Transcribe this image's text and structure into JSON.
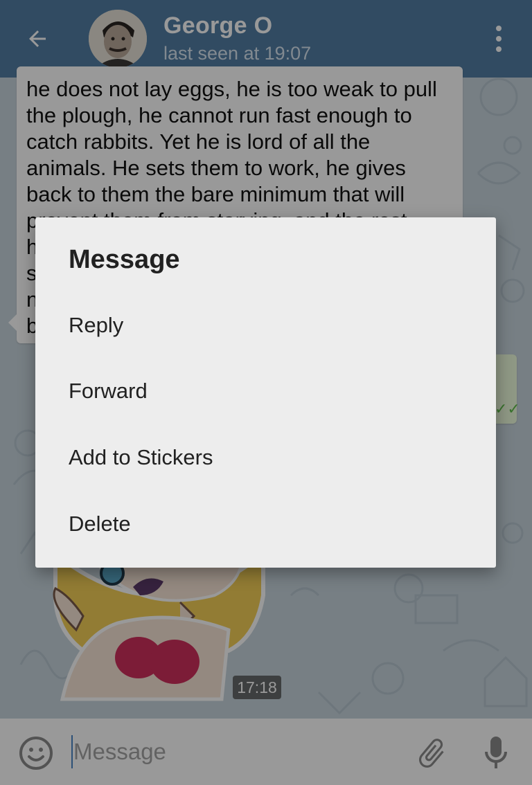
{
  "header": {
    "title": "George O",
    "subtitle": "last seen at 19:07"
  },
  "message": {
    "text": "he does not lay eggs, he is too weak to pull\nthe plough, he cannot run fast enough to\ncatch rabbits. Yet he is lord of all the\nanimals. He sets them to work, he gives\nback to them the bare minimum that will\nprevent them from starving, and the rest\nhe\ns\nn\nb"
  },
  "sticker": {
    "time": "17:18"
  },
  "input": {
    "placeholder": "Message"
  },
  "dialog": {
    "title": "Message",
    "items": [
      {
        "label": "Reply"
      },
      {
        "label": "Forward"
      },
      {
        "label": "Add to Stickers"
      },
      {
        "label": "Delete"
      }
    ]
  },
  "icons": {
    "back": "arrow-left-icon",
    "menu": "more-vertical-icon",
    "emoji": "smiley-icon",
    "attach": "paperclip-icon",
    "mic": "microphone-icon"
  },
  "colors": {
    "header": "#527da3",
    "dialog_bg": "#ededed",
    "outgoing_bubble": "#effdde",
    "check": "#5fbf4b"
  }
}
